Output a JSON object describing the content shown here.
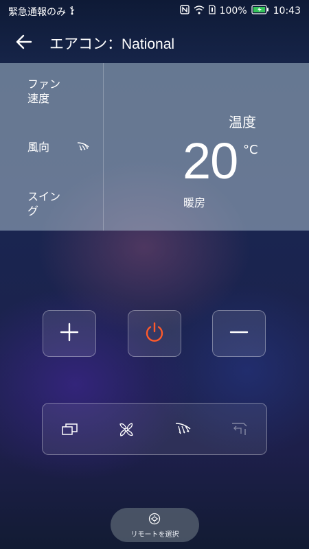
{
  "status_bar": {
    "left_text": "緊急通報のみ",
    "usb_icon": "usb-icon",
    "nfc_icon": "nfc-icon",
    "wifi_icon": "wifi-icon",
    "sim_icon": "sim-icon",
    "battery_percent": "100%",
    "battery_icon": "battery-charging-icon",
    "battery_color": "#35c35a",
    "time": "10:43"
  },
  "header": {
    "back_icon": "back-arrow-icon",
    "title": "エアコン：National"
  },
  "panel": {
    "fan_speed_label": "ファン\n速度",
    "wind_direction_label": "風向",
    "wind_direction_icon": "wind-direction-icon",
    "swing_label": "スイン\nグ",
    "temperature_label": "温度",
    "temperature_value": "20",
    "temperature_unit": "°C",
    "mode": "暖房"
  },
  "controls": {
    "plus_icon": "plus-icon",
    "power_icon": "power-icon",
    "power_color": "#ff5a2a",
    "minus_icon": "minus-icon"
  },
  "function_bar": {
    "items": [
      {
        "icon": "mode-icon",
        "enabled": true
      },
      {
        "icon": "fan-icon",
        "enabled": true
      },
      {
        "icon": "wind-direction-icon",
        "enabled": true
      },
      {
        "icon": "swing-icon",
        "enabled": false
      }
    ]
  },
  "remote_selector": {
    "icon": "remote-icon",
    "label": "リモートを選択"
  }
}
